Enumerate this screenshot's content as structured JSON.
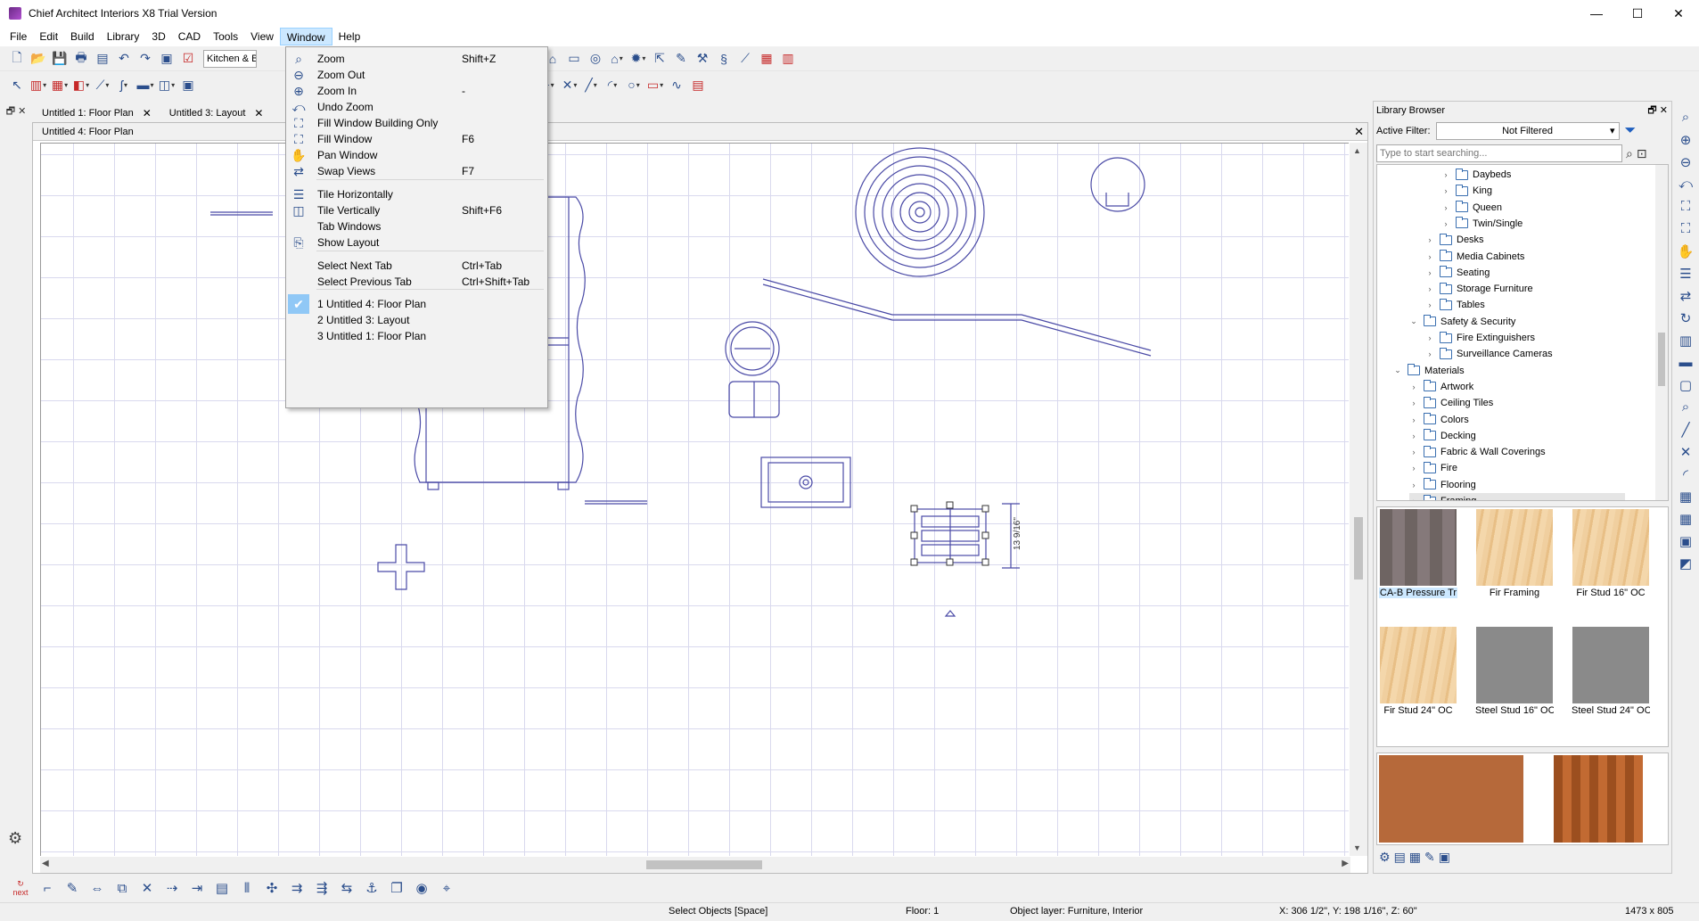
{
  "window": {
    "title": "Chief Architect Interiors X8 Trial Version",
    "controls": [
      "—",
      "☐",
      "✕"
    ]
  },
  "menubar": [
    "File",
    "Edit",
    "Build",
    "Library",
    "3D",
    "CAD",
    "Tools",
    "View",
    "Window",
    "Help"
  ],
  "toolbar": {
    "room_combo": "Kitchen & B"
  },
  "tabs": [
    {
      "label": "Untitled 1: Floor Plan",
      "close": "✕"
    },
    {
      "label": "Untitled 3: Layout",
      "close": "✕"
    }
  ],
  "drawing_window": {
    "title": "Untitled 4: Floor Plan",
    "close": "✕",
    "dimension_label": "13 9/16\""
  },
  "window_menu": {
    "items": [
      {
        "label": "Zoom",
        "shortcut": "Shift+Z",
        "icon": "⌕"
      },
      {
        "label": "Zoom Out",
        "shortcut": "",
        "icon": "⊖"
      },
      {
        "label": "Zoom In",
        "shortcut": "-",
        "icon": "⊕"
      },
      {
        "label": "Undo Zoom",
        "shortcut": "",
        "icon": "⤺"
      },
      {
        "label": "Fill Window Building Only",
        "shortcut": "",
        "icon": "⛶"
      },
      {
        "label": "Fill Window",
        "shortcut": "F6",
        "icon": "⛶"
      },
      {
        "label": "Pan Window",
        "shortcut": "",
        "icon": "✋"
      },
      {
        "label": "Swap Views",
        "shortcut": "F7",
        "icon": "⇄"
      },
      {
        "label": "Tile Horizontally",
        "shortcut": "",
        "icon": "☰"
      },
      {
        "label": "Tile Vertically",
        "shortcut": "Shift+F6",
        "icon": "◫"
      },
      {
        "label": "Tab Windows",
        "shortcut": "",
        "icon": ""
      },
      {
        "label": "Show Layout",
        "shortcut": "",
        "icon": "⎘"
      },
      {
        "label": "Select Next Tab",
        "shortcut": "Ctrl+Tab",
        "icon": ""
      },
      {
        "label": "Select Previous Tab",
        "shortcut": "Ctrl+Shift+Tab",
        "icon": ""
      },
      {
        "label": "1 Untitled 4: Floor Plan",
        "shortcut": "",
        "icon": "✔"
      },
      {
        "label": "2 Untitled 3: Layout",
        "shortcut": "",
        "icon": ""
      },
      {
        "label": "3 Untitled 1: Floor Plan",
        "shortcut": "",
        "icon": ""
      }
    ]
  },
  "library": {
    "title": "Library Browser",
    "title_controls": "🗗 ✕",
    "filter_label": "Active Filter:",
    "filter_value": "Not Filtered",
    "search_placeholder": "Type to start searching...",
    "tree": [
      {
        "label": "Daybeds",
        "level": 4
      },
      {
        "label": "King",
        "level": 4
      },
      {
        "label": "Queen",
        "level": 4
      },
      {
        "label": "Twin/Single",
        "level": 4
      },
      {
        "label": "Desks",
        "level": 3
      },
      {
        "label": "Media Cabinets",
        "level": 3
      },
      {
        "label": "Seating",
        "level": 3
      },
      {
        "label": "Storage Furniture",
        "level": 3
      },
      {
        "label": "Tables",
        "level": 3
      },
      {
        "label": "Safety & Security",
        "level": 2,
        "expanded": true
      },
      {
        "label": "Fire Extinguishers",
        "level": 3
      },
      {
        "label": "Surveillance Cameras",
        "level": 3
      },
      {
        "label": "Materials",
        "level": 1,
        "expanded": true
      },
      {
        "label": "Artwork",
        "level": 2
      },
      {
        "label": "Ceiling Tiles",
        "level": 2
      },
      {
        "label": "Colors",
        "level": 2
      },
      {
        "label": "Decking",
        "level": 2
      },
      {
        "label": "Fabric & Wall Coverings",
        "level": 2
      },
      {
        "label": "Fire",
        "level": 2
      },
      {
        "label": "Flooring",
        "level": 2
      },
      {
        "label": "Framing",
        "level": 2,
        "selected": true
      }
    ],
    "thumbnails": [
      {
        "label": "CA-B Pressure Tr",
        "texture": "pressure",
        "selected": true
      },
      {
        "label": "Fir Framing",
        "texture": "fir"
      },
      {
        "label": "Fir Stud 16\" OC",
        "texture": "fir"
      },
      {
        "label": "Fir Stud 24\" OC",
        "texture": "fir"
      },
      {
        "label": "Steel Stud 16\" OC",
        "texture": "steel"
      },
      {
        "label": "Steel Stud 24\" OC",
        "texture": "steel"
      }
    ]
  },
  "bottombar": {
    "next_label": "next"
  },
  "status": {
    "mode": "Select Objects [Space]",
    "floor": "Floor: 1",
    "layer": "Object layer: Furniture, Interior",
    "coords": "X: 306 1/2\", Y: 198 1/16\", Z: 60\"",
    "size": "1473 x 805"
  }
}
